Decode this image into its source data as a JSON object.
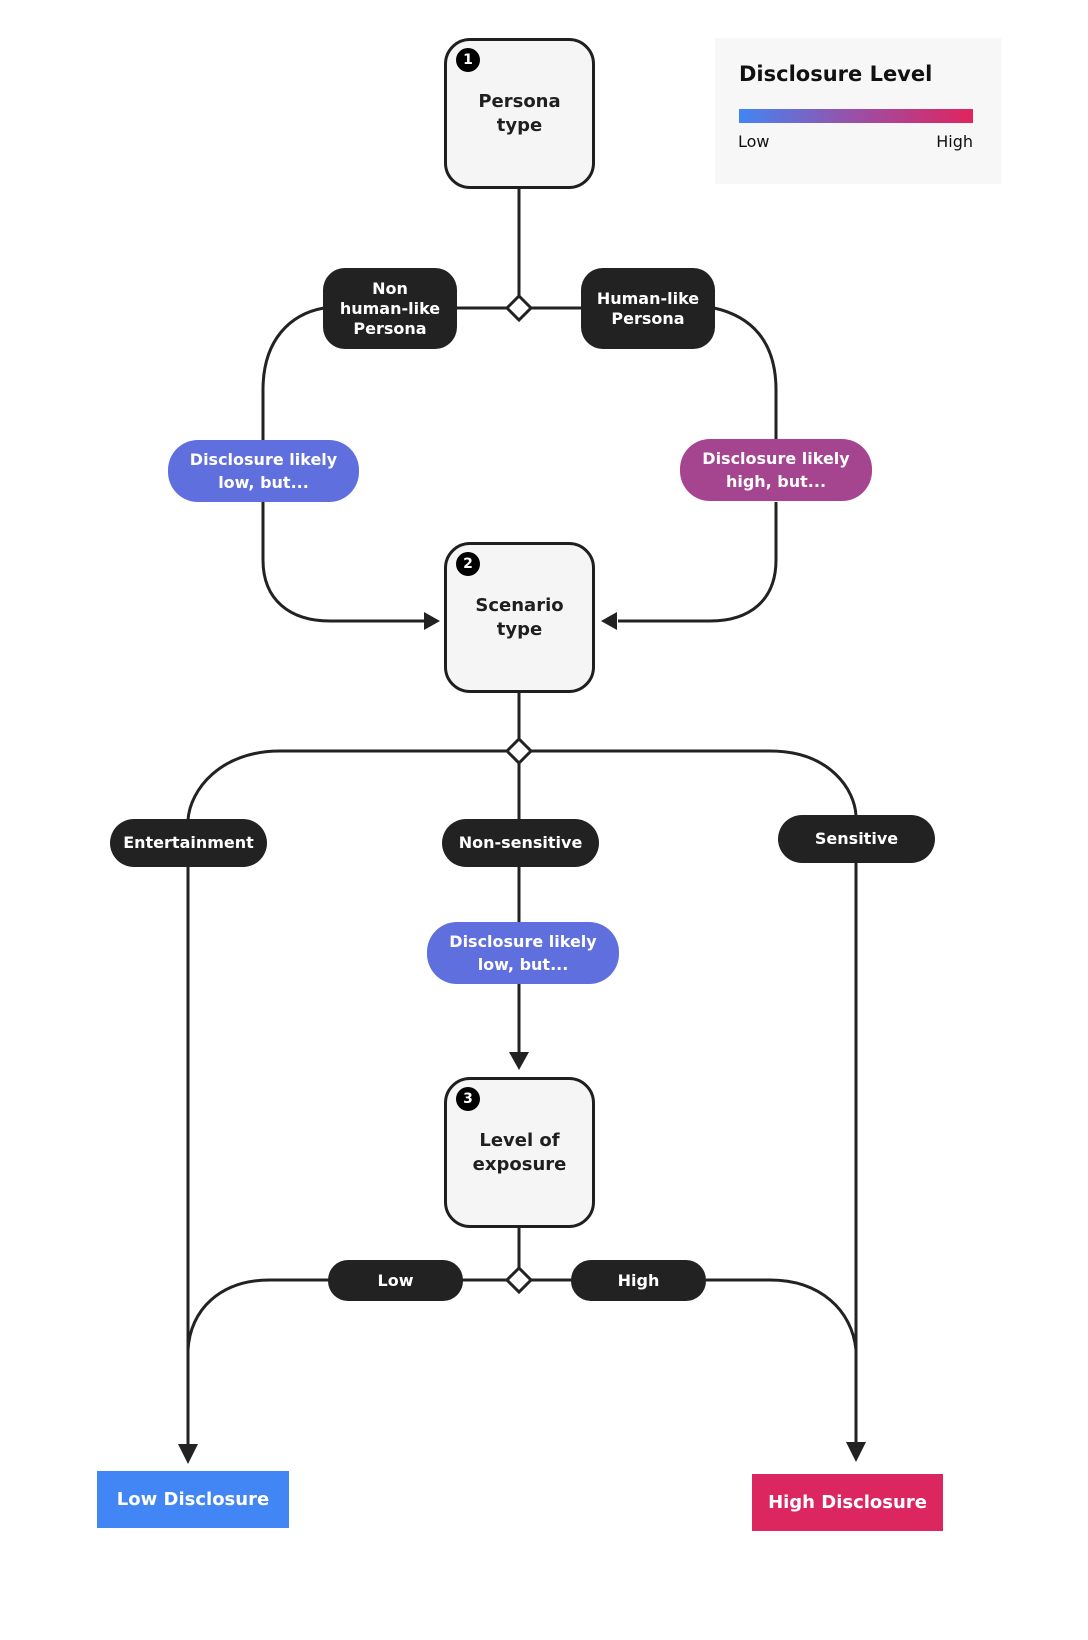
{
  "legend": {
    "title": "Disclosure Level",
    "low_label": "Low",
    "high_label": "High",
    "gradient_start": "#4285f4",
    "gradient_end": "#e0245e"
  },
  "nodes": [
    {
      "number": "1",
      "label": "Persona\ntype"
    },
    {
      "number": "2",
      "label": "Scenario\ntype"
    },
    {
      "number": "3",
      "label": "Level of\nexposure"
    }
  ],
  "persona_branches": {
    "non_human": "Non\nhuman-like\nPersona",
    "human": "Human-like\nPersona"
  },
  "notes": {
    "non_human": "Disclosure likely\nlow, but...",
    "human": "Disclosure likely\nhigh, but...",
    "non_sensitive": "Disclosure likely\nlow, but..."
  },
  "scenario_branches": {
    "entertainment": "Entertainment",
    "non_sensitive": "Non-sensitive",
    "sensitive": "Sensitive"
  },
  "exposure_branches": {
    "low": "Low",
    "high": "High"
  },
  "outcomes": {
    "low": "Low Disclosure",
    "high": "High Disclosure"
  },
  "colors": {
    "low_note": "#5f6fde",
    "high_note": "#a5448f",
    "low_outcome": "#4285f4",
    "high_outcome": "#dc2660",
    "pill": "#222222"
  }
}
